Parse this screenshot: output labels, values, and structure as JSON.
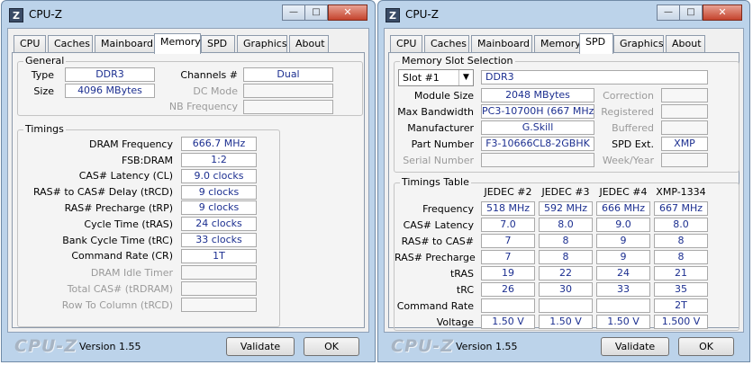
{
  "left_window": {
    "title": "CPU-Z",
    "controls": {
      "min": "—",
      "max": "□",
      "close": "✕"
    },
    "tabs": [
      "CPU",
      "Caches",
      "Mainboard",
      "Memory",
      "SPD",
      "Graphics",
      "About"
    ],
    "active_tab": "Memory",
    "general": {
      "title": "General",
      "type_label": "Type",
      "type_value": "DDR3",
      "size_label": "Size",
      "size_value": "4096 MBytes",
      "channels_label": "Channels #",
      "channels_value": "Dual",
      "dcmode_label": "DC Mode",
      "dcmode_value": "",
      "nbfreq_label": "NB Frequency",
      "nbfreq_value": ""
    },
    "timings": {
      "title": "Timings",
      "rows": [
        {
          "label": "DRAM Frequency",
          "value": "666.7 MHz",
          "dim": false
        },
        {
          "label": "FSB:DRAM",
          "value": "1:2",
          "dim": false
        },
        {
          "label": "CAS# Latency (CL)",
          "value": "9.0 clocks",
          "dim": false
        },
        {
          "label": "RAS# to CAS# Delay (tRCD)",
          "value": "9 clocks",
          "dim": false
        },
        {
          "label": "RAS# Precharge (tRP)",
          "value": "9 clocks",
          "dim": false
        },
        {
          "label": "Cycle Time (tRAS)",
          "value": "24 clocks",
          "dim": false
        },
        {
          "label": "Bank Cycle Time (tRC)",
          "value": "33 clocks",
          "dim": false
        },
        {
          "label": "Command Rate (CR)",
          "value": "1T",
          "dim": false
        },
        {
          "label": "DRAM Idle Timer",
          "value": "",
          "dim": true
        },
        {
          "label": "Total CAS# (tRDRAM)",
          "value": "",
          "dim": true
        },
        {
          "label": "Row To Column (tRCD)",
          "value": "",
          "dim": true
        }
      ]
    },
    "footer": {
      "logo": "CPU-Z",
      "version": "Version 1.55",
      "validate": "Validate",
      "ok": "OK"
    }
  },
  "right_window": {
    "title": "CPU-Z",
    "controls": {
      "min": "—",
      "max": "□",
      "close": "✕"
    },
    "tabs": [
      "CPU",
      "Caches",
      "Mainboard",
      "Memory",
      "SPD",
      "Graphics",
      "About"
    ],
    "active_tab": "SPD",
    "slot": {
      "title": "Memory Slot Selection",
      "selected": "Slot #1",
      "type": "DDR3",
      "rows": [
        {
          "label": "Module Size",
          "value": "2048 MBytes",
          "rlabel": "Correction",
          "rvalue": "",
          "dim": false,
          "rdim": true
        },
        {
          "label": "Max Bandwidth",
          "value": "PC3-10700H (667 MHz)",
          "rlabel": "Registered",
          "rvalue": "",
          "dim": false,
          "rdim": true
        },
        {
          "label": "Manufacturer",
          "value": "G.Skill",
          "rlabel": "Buffered",
          "rvalue": "",
          "dim": false,
          "rdim": true
        },
        {
          "label": "Part Number",
          "value": "F3-10666CL8-2GBHK",
          "rlabel": "SPD Ext.",
          "rvalue": "XMP",
          "dim": false,
          "rdim": false
        },
        {
          "label": "Serial Number",
          "value": "",
          "rlabel": "Week/Year",
          "rvalue": "",
          "dim": true,
          "rdim": true
        }
      ]
    },
    "timings_table": {
      "title": "Timings Table",
      "columns": [
        "JEDEC #2",
        "JEDEC #3",
        "JEDEC #4",
        "XMP-1334"
      ],
      "rows": [
        {
          "label": "Frequency",
          "values": [
            "518 MHz",
            "592 MHz",
            "666 MHz",
            "667 MHz"
          ]
        },
        {
          "label": "CAS# Latency",
          "values": [
            "7.0",
            "8.0",
            "9.0",
            "8.0"
          ]
        },
        {
          "label": "RAS# to CAS#",
          "values": [
            "7",
            "8",
            "9",
            "8"
          ]
        },
        {
          "label": "RAS# Precharge",
          "values": [
            "7",
            "8",
            "9",
            "8"
          ]
        },
        {
          "label": "tRAS",
          "values": [
            "19",
            "22",
            "24",
            "21"
          ]
        },
        {
          "label": "tRC",
          "values": [
            "26",
            "30",
            "33",
            "35"
          ]
        },
        {
          "label": "Command Rate",
          "values": [
            "",
            "",
            "",
            "2T"
          ]
        },
        {
          "label": "Voltage",
          "values": [
            "1.50 V",
            "1.50 V",
            "1.50 V",
            "1.500 V"
          ]
        }
      ]
    },
    "footer": {
      "logo": "CPU-Z",
      "version": "Version 1.55",
      "validate": "Validate",
      "ok": "OK"
    }
  }
}
